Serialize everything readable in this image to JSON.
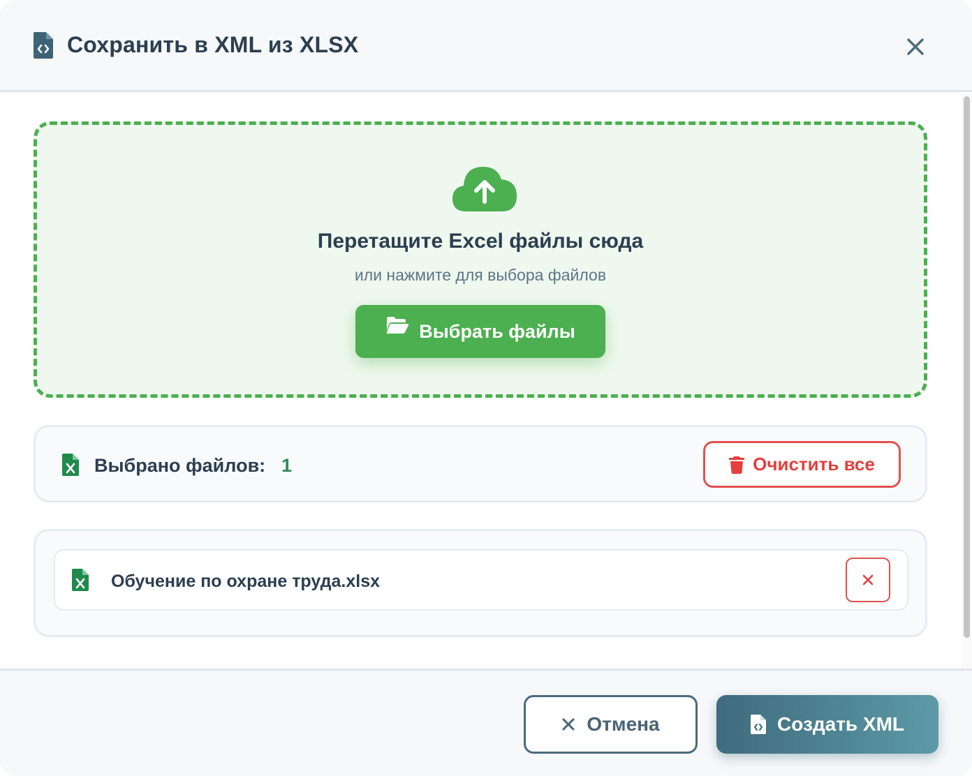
{
  "dialog": {
    "title": "Сохранить в XML из XLSX",
    "title_icon": "file-code-icon",
    "close_icon": "close-icon"
  },
  "dropzone": {
    "icon": "cloud-upload-icon",
    "title": "Перетащите Excel файлы сюда",
    "subtitle": "или нажмите для выбора файлов",
    "choose_label": "Выбрать файлы",
    "choose_icon": "folder-open-icon"
  },
  "summary": {
    "icon": "excel-file-icon",
    "label": "Выбрано файлов:",
    "count": "1",
    "clear_label": "Очистить все",
    "clear_icon": "trash-icon"
  },
  "files": [
    {
      "name": "Обучение по охране труда.xlsx",
      "icon": "excel-file-icon",
      "remove_icon": "remove-icon"
    }
  ],
  "footer": {
    "cancel_label": "Отмена",
    "cancel_icon": "close-icon",
    "create_label": "Создать XML",
    "create_icon": "file-code-icon"
  },
  "colors": {
    "accent_green": "#4caf50",
    "danger_red": "#e53e3e",
    "primary_teal": "#3f6b7d",
    "text_dark": "#2c3e50",
    "count_green": "#2e8b57"
  }
}
